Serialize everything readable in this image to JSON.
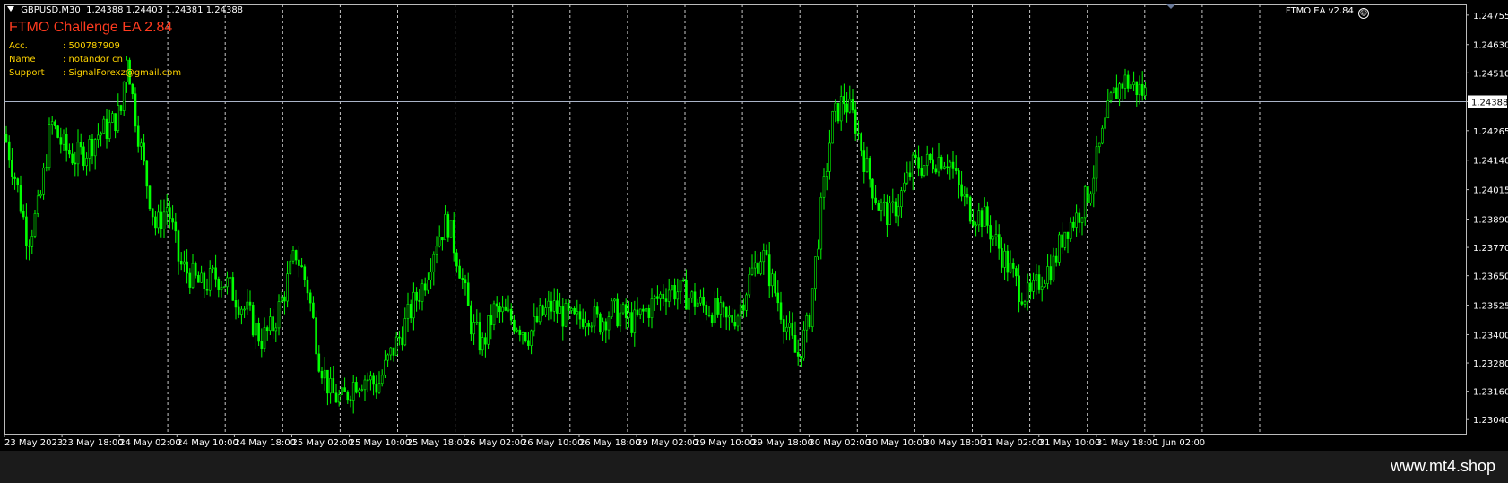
{
  "window": {
    "symbol": "GBPUSD,M30",
    "ohlc": "1.24388 1.24403 1.24381 1.24388",
    "ea_badge": "FTMO EA  v2.84",
    "smile_glyph": "☺"
  },
  "ea_panel": {
    "title": "FTMO Challenge EA 2.84",
    "rows": [
      {
        "label": "Acc.",
        "value": ": 500787909"
      },
      {
        "label": "Name",
        "value": ": notandor cn"
      },
      {
        "label": "Support",
        "value": ": SignalForexz@gmail.com"
      }
    ]
  },
  "footer": {
    "site": "www.mt4.shop"
  },
  "colors": {
    "candle": "#00ff00",
    "grid": "#c8c8c8",
    "bid_line": "#aab4c8",
    "axis_text": "#ffffff",
    "title": "#ff3b1f",
    "info": "#ffd400"
  },
  "chart_data": {
    "type": "candlestick",
    "symbol": "GBPUSD",
    "timeframe": "M30",
    "current_price": "1.24388",
    "y_ticks": [
      "1.24755",
      "1.24630",
      "1.24510",
      "1.24388",
      "1.24265",
      "1.24140",
      "1.24015",
      "1.23890",
      "1.23770",
      "1.23650",
      "1.23525",
      "1.23400",
      "1.23280",
      "1.23160",
      "1.23040"
    ],
    "ylim": [
      1.2298,
      1.248
    ],
    "x_labels": [
      "23 May 2023",
      "23 May 18:00",
      "24 May 02:00",
      "24 May 10:00",
      "24 May 18:00",
      "25 May 02:00",
      "25 May 10:00",
      "25 May 18:00",
      "26 May 02:00",
      "26 May 10:00",
      "26 May 18:00",
      "29 May 02:00",
      "29 May 10:00",
      "29 May 18:00",
      "30 May 02:00",
      "30 May 10:00",
      "30 May 18:00",
      "31 May 02:00",
      "31 May 10:00",
      "31 May 18:00",
      "1 Jun 02:00"
    ],
    "price_path": [
      [
        0,
        1.2425
      ],
      [
        0.02,
        1.2405
      ],
      [
        0.04,
        1.238
      ],
      [
        0.06,
        1.2395
      ],
      [
        0.08,
        1.243
      ],
      [
        0.1,
        1.242
      ],
      [
        0.12,
        1.2415
      ],
      [
        0.14,
        1.2418
      ],
      [
        0.16,
        1.2425
      ],
      [
        0.18,
        1.2428
      ],
      [
        0.2,
        1.2435
      ],
      [
        0.21,
        1.246
      ],
      [
        0.22,
        1.244
      ],
      [
        0.24,
        1.241
      ],
      [
        0.26,
        1.2385
      ],
      [
        0.28,
        1.2395
      ],
      [
        0.3,
        1.237
      ],
      [
        0.32,
        1.2365
      ],
      [
        0.34,
        1.236
      ],
      [
        0.36,
        1.2365
      ],
      [
        0.38,
        1.2362
      ],
      [
        0.4,
        1.2355
      ],
      [
        0.42,
        1.2348
      ],
      [
        0.44,
        1.2338
      ],
      [
        0.46,
        1.2343
      ],
      [
        0.48,
        1.2358
      ],
      [
        0.5,
        1.2375
      ],
      [
        0.52,
        1.236
      ],
      [
        0.54,
        1.233
      ],
      [
        0.56,
        1.2315
      ],
      [
        0.58,
        1.2312
      ],
      [
        0.6,
        1.232
      ],
      [
        0.62,
        1.2322
      ],
      [
        0.64,
        1.2318
      ],
      [
        0.66,
        1.233
      ],
      [
        0.68,
        1.234
      ],
      [
        0.7,
        1.2352
      ],
      [
        0.72,
        1.2362
      ],
      [
        0.74,
        1.238
      ],
      [
        0.76,
        1.2388
      ],
      [
        0.78,
        1.237
      ],
      [
        0.8,
        1.2345
      ],
      [
        0.82,
        1.2335
      ],
      [
        0.84,
        1.235
      ],
      [
        0.86,
        1.2348
      ],
      [
        0.88,
        1.2345
      ],
      [
        0.9,
        1.234
      ],
      [
        0.92,
        1.2348
      ],
      [
        0.94,
        1.2352
      ],
      [
        0.96,
        1.2348
      ],
      [
        0.98,
        1.2345
      ],
      [
        1.0,
        1.235
      ],
      [
        1.02,
        1.2345
      ],
      [
        1.04,
        1.235
      ],
      [
        1.06,
        1.2348
      ],
      [
        1.08,
        1.2345
      ],
      [
        1.1,
        1.235
      ],
      [
        1.12,
        1.2355
      ],
      [
        1.14,
        1.236
      ],
      [
        1.16,
        1.2358
      ],
      [
        1.18,
        1.2355
      ],
      [
        1.2,
        1.2352
      ],
      [
        1.22,
        1.235
      ],
      [
        1.24,
        1.2345
      ],
      [
        1.26,
        1.235
      ],
      [
        1.28,
        1.2365
      ],
      [
        1.3,
        1.2375
      ],
      [
        1.32,
        1.236
      ],
      [
        1.34,
        1.2345
      ],
      [
        1.36,
        1.233
      ],
      [
        1.38,
        1.2345
      ],
      [
        1.4,
        1.239
      ],
      [
        1.42,
        1.243
      ],
      [
        1.44,
        1.244
      ],
      [
        1.46,
        1.243
      ],
      [
        1.48,
        1.241
      ],
      [
        1.5,
        1.2395
      ],
      [
        1.52,
        1.239
      ],
      [
        1.54,
        1.24
      ],
      [
        1.56,
        1.2412
      ],
      [
        1.58,
        1.2412
      ],
      [
        1.6,
        1.2415
      ],
      [
        1.62,
        1.2415
      ],
      [
        1.64,
        1.24
      ],
      [
        1.66,
        1.2392
      ],
      [
        1.68,
        1.239
      ],
      [
        1.7,
        1.238
      ],
      [
        1.72,
        1.237
      ],
      [
        1.74,
        1.236
      ],
      [
        1.76,
        1.2355
      ],
      [
        1.78,
        1.2365
      ],
      [
        1.8,
        1.237
      ],
      [
        1.82,
        1.2385
      ],
      [
        1.84,
        1.239
      ],
      [
        1.86,
        1.24
      ],
      [
        1.88,
        1.242
      ],
      [
        1.9,
        1.244
      ],
      [
        1.92,
        1.2448
      ],
      [
        1.94,
        1.2445
      ],
      [
        1.96,
        1.2442
      ]
    ]
  }
}
